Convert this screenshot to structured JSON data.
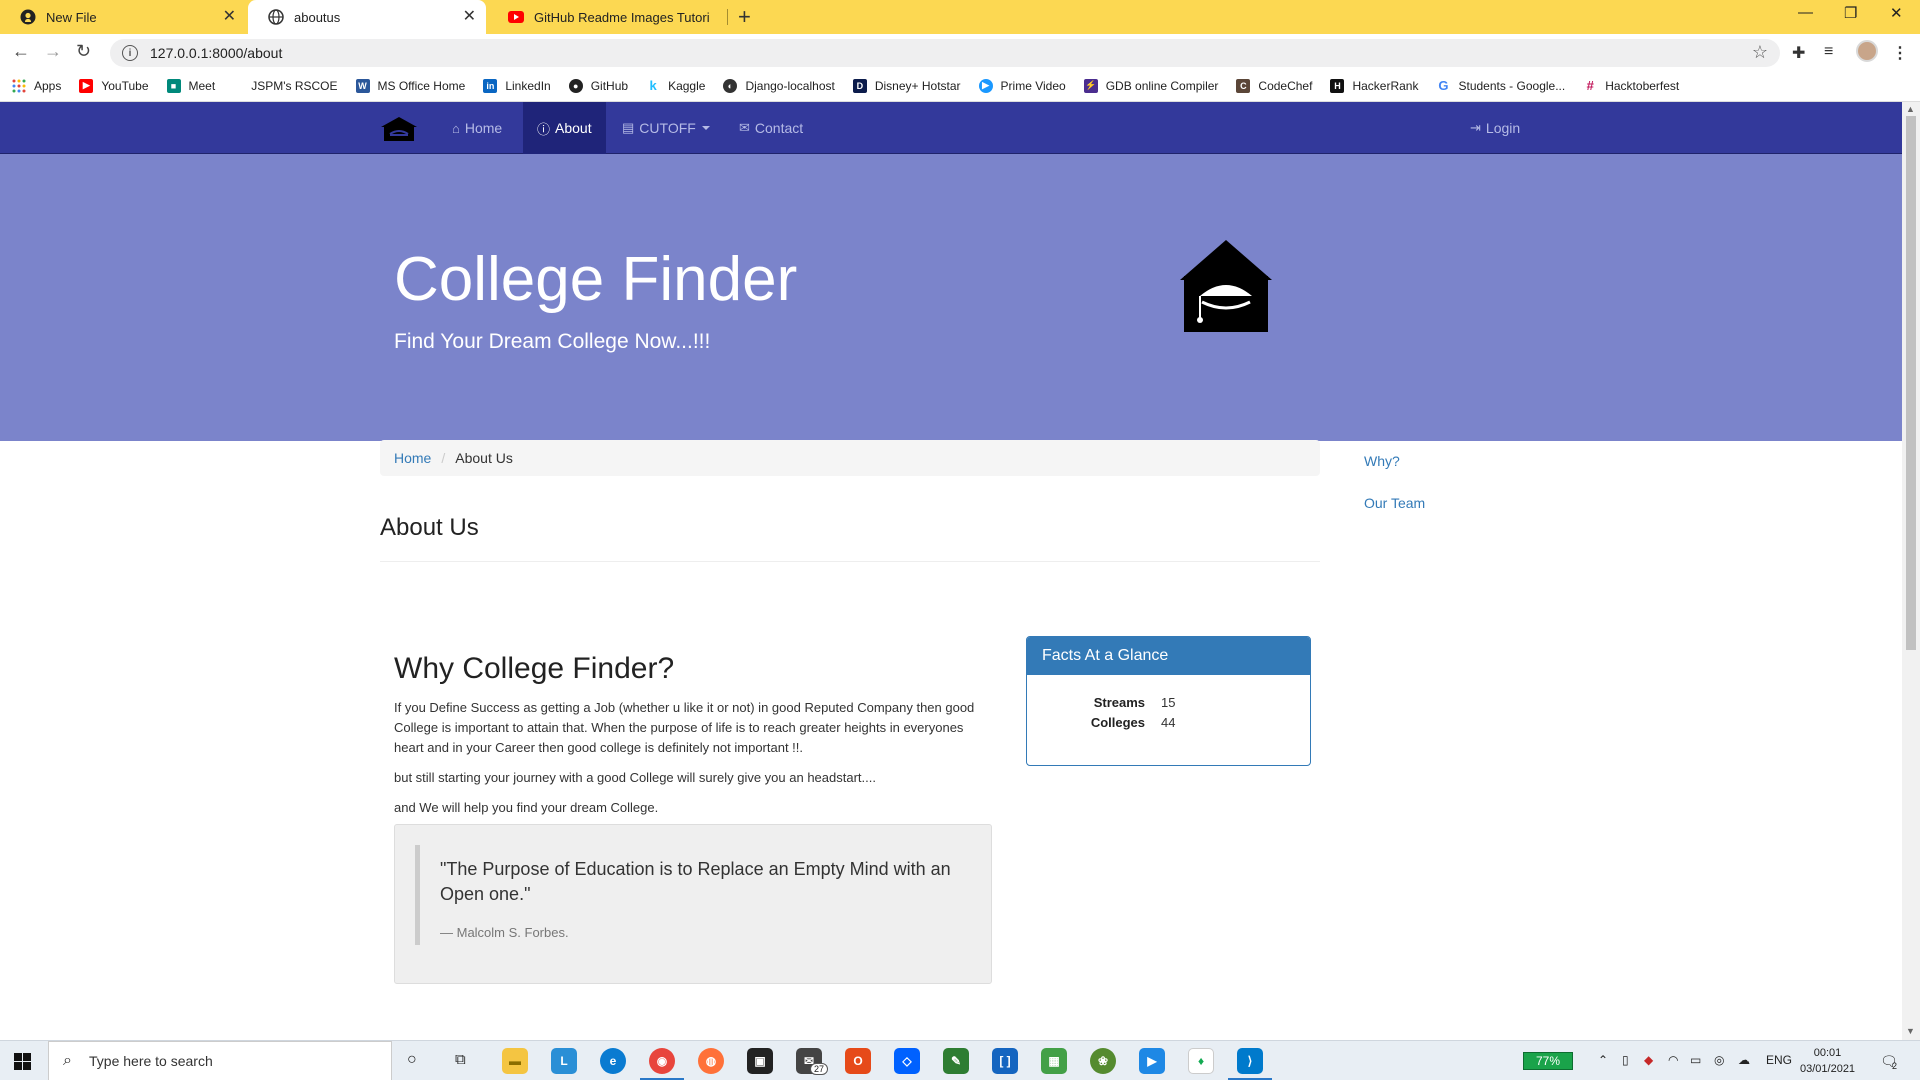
{
  "browser": {
    "tabs": [
      {
        "title": "New File",
        "icon": "github-icon"
      },
      {
        "title": "aboutus",
        "icon": "globe-icon"
      },
      {
        "title": "GitHub Readme Images Tutorial",
        "icon": "youtube-icon"
      }
    ],
    "url": "127.0.0.1:8000/about",
    "bookmarks": [
      {
        "label": "Apps",
        "icon": "apps-grid-icon",
        "color": "#e2453c"
      },
      {
        "label": "YouTube",
        "icon": "youtube-icon",
        "color": "#ff0000"
      },
      {
        "label": "Meet",
        "icon": "meet-icon",
        "color": "#00897b"
      },
      {
        "label": "JSPM's RSCOE",
        "icon": "college-icon",
        "color": "#ffffff"
      },
      {
        "label": "MS Office Home",
        "icon": "word-icon",
        "color": "#2b579a"
      },
      {
        "label": "LinkedIn",
        "icon": "linkedin-icon",
        "color": "#0a66c2"
      },
      {
        "label": "GitHub",
        "icon": "github-icon",
        "color": "#222222"
      },
      {
        "label": "Kaggle",
        "icon": "kaggle-icon",
        "color": "#20beff"
      },
      {
        "label": "Django-localhost",
        "icon": "globe-icon",
        "color": "#333333"
      },
      {
        "label": "Disney+ Hotstar",
        "icon": "hotstar-icon",
        "color": "#0c1c4c"
      },
      {
        "label": "Prime Video",
        "icon": "prime-video-icon",
        "color": "#1a98ff"
      },
      {
        "label": "GDB online Compiler",
        "icon": "gdb-icon",
        "color": "#4b2d8f"
      },
      {
        "label": "CodeChef",
        "icon": "codechef-icon",
        "color": "#5b4638"
      },
      {
        "label": "HackerRank",
        "icon": "hackerrank-icon",
        "color": "#111111"
      },
      {
        "label": "Students - Google...",
        "icon": "google-icon",
        "color": "#4285f4"
      },
      {
        "label": "Hacktoberfest",
        "icon": "hacktoberfest-icon",
        "color": "#c2185b"
      }
    ]
  },
  "navbar": {
    "items": [
      {
        "label": "Home",
        "icon": "home-icon"
      },
      {
        "label": "About",
        "icon": "info-icon"
      },
      {
        "label": "CUTOFF",
        "icon": "list-icon"
      },
      {
        "label": "Contact",
        "icon": "envelope-icon"
      }
    ],
    "login": "Login"
  },
  "hero": {
    "title": "College Finder",
    "subtitle": "Find Your Dream College Now...!!!"
  },
  "breadcrumb": {
    "home": "Home",
    "current": "About Us"
  },
  "sidebar": {
    "why": "Why?",
    "team": "Our Team"
  },
  "page": {
    "heading": "About Us"
  },
  "why": {
    "heading": "Why College Finder?",
    "p1": "If you Define Success as getting a Job (whether u like it or not) in good Reputed Company then good College is important to attain that. When the purpose of life is to reach greater heights in everyones heart and in your Career then good college is definitely not important !!.",
    "p2": "but still starting your journey with a good College will surely give you an headstart....",
    "p3": "and We will help you find your dream College."
  },
  "quote": {
    "text": "\"The Purpose of Education is to Replace an Empty Mind with an Open one.\"",
    "author": "— Malcolm S. Forbes."
  },
  "facts": {
    "title": "Facts At a Glance",
    "rows": [
      {
        "label": "Streams",
        "value": "15"
      },
      {
        "label": "Colleges",
        "value": "44"
      }
    ]
  },
  "taskbar": {
    "search_placeholder": "Type here to search",
    "battery": "77%",
    "lang": "ENG",
    "time": "00:01",
    "date": "03/01/2021",
    "mail_badge": "27",
    "notif_count": "2"
  },
  "colors": {
    "navbar": "#33399b",
    "hero": "#7b84cb",
    "panel": "#337ab7",
    "tabbar": "#fcd852"
  }
}
